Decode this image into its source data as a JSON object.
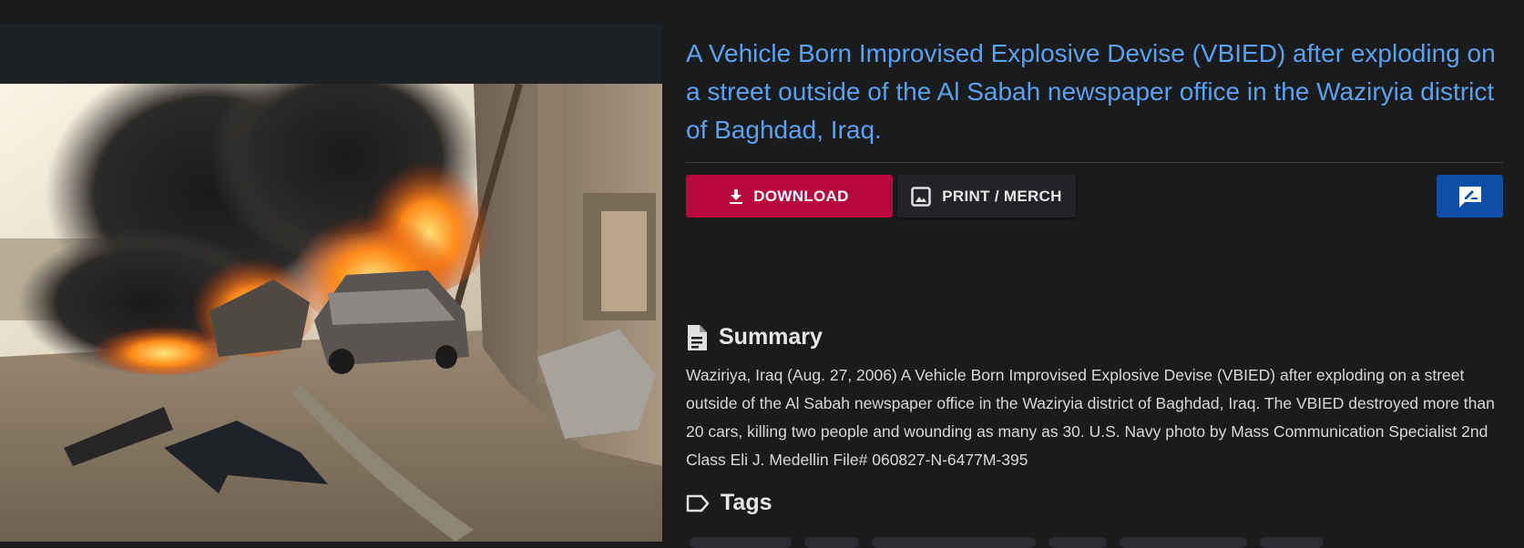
{
  "title": "A Vehicle Born Improvised Explosive Devise (VBIED) after exploding on a street outside of the Al Sabah newspaper office in the Waziryia district of Baghdad, Iraq.",
  "actions": {
    "download_label": "DOWNLOAD",
    "print_label": "PRINT / MERCH",
    "download_icon": "download-icon",
    "print_icon": "image-icon",
    "feedback_icon": "feedback-icon"
  },
  "summary": {
    "heading": "Summary",
    "icon": "document-icon",
    "text": "Waziriya, Iraq (Aug. 27, 2006) A Vehicle Born Improvised Explosive Devise (VBIED) after exploding on a street outside of the Al Sabah newspaper office in the Waziryia district of Baghdad, Iraq. The VBIED destroyed more than 20 cars, killing two people and wounding as many as 30. U.S. Navy photo by Mass Communication Specialist 2nd Class Eli J. Medellin File# 060827-N-6477M-395"
  },
  "tags": {
    "heading": "Tags",
    "icon": "label-icon"
  },
  "colors": {
    "page_bg": "#1a1b1d",
    "title": "#5aa2f0",
    "download_bg": "#b8073f",
    "feedback_bg": "#0d4fa8"
  }
}
